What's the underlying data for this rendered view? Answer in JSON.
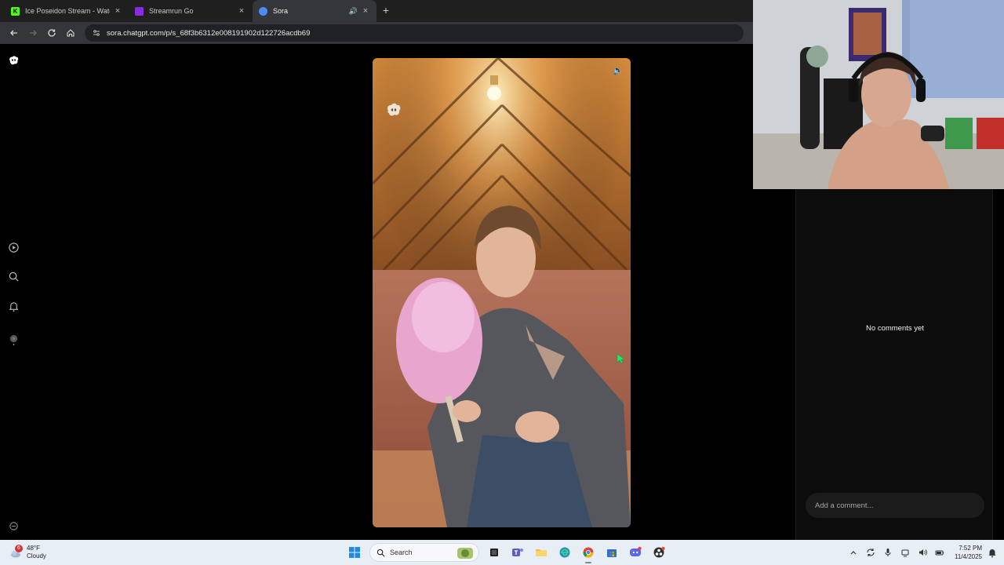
{
  "browser": {
    "tabs": [
      {
        "title": "Ice Poseidon Stream - Watch Li",
        "favicon_letter": "K",
        "favicon_color": "#53fc18",
        "active": false
      },
      {
        "title": "Streamrun Go",
        "favicon_letter": "",
        "favicon_color": "#8a2be2",
        "active": false
      },
      {
        "title": "Sora",
        "favicon_letter": "",
        "favicon_color": "#4b8df8",
        "active": true
      }
    ],
    "url": "sora.chatgpt.com/p/s_68f3b6312e008191902d122726acdb69"
  },
  "sora": {
    "comments_empty": "No comments yet",
    "comment_placeholder": "Add a comment..."
  },
  "taskbar": {
    "weather_badge": "6",
    "temperature": "48°F",
    "condition": "Cloudy",
    "search_label": "Search",
    "time": "7:52 PM",
    "date": "11/4/2025"
  },
  "colors": {
    "page_bg": "#000000",
    "tab_strip": "#1f1f1f",
    "toolbar": "#35363a",
    "taskbar": "#e8eef6"
  }
}
